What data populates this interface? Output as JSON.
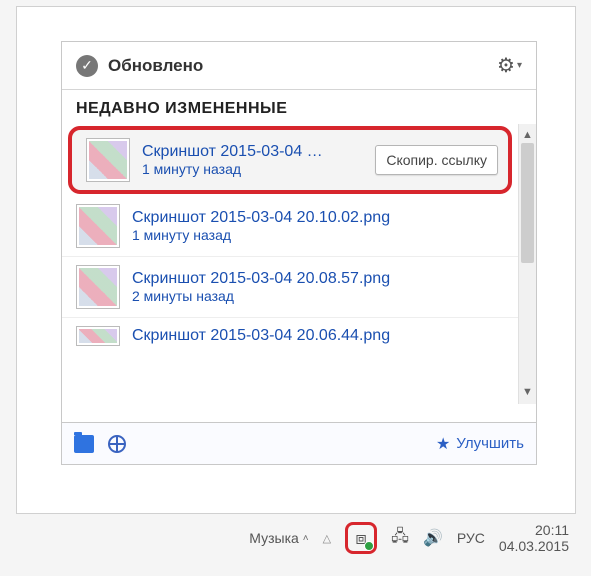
{
  "header": {
    "status_text": "Обновлено",
    "gear_icon": "settings"
  },
  "section_title": "НЕДАВНО ИЗМЕНЕННЫЕ",
  "items": [
    {
      "title": "Скриншот 2015-03-04 …",
      "sub": "1 минуту назад",
      "highlight": true,
      "copy_label": "Скопир. ссылку"
    },
    {
      "title": "Скриншот 2015-03-04 20.10.02.png",
      "sub": "1 минуту назад"
    },
    {
      "title": "Скриншот 2015-03-04 20.08.57.png",
      "sub": "2 минуты назад"
    },
    {
      "title": "Скриншот 2015-03-04 20.06.44.png",
      "sub": ""
    }
  ],
  "footer": {
    "upgrade_label": "Улучшить"
  },
  "taskbar": {
    "music_label": "Музыка",
    "lang": "РУС",
    "time": "20:11",
    "date": "04.03.2015"
  }
}
